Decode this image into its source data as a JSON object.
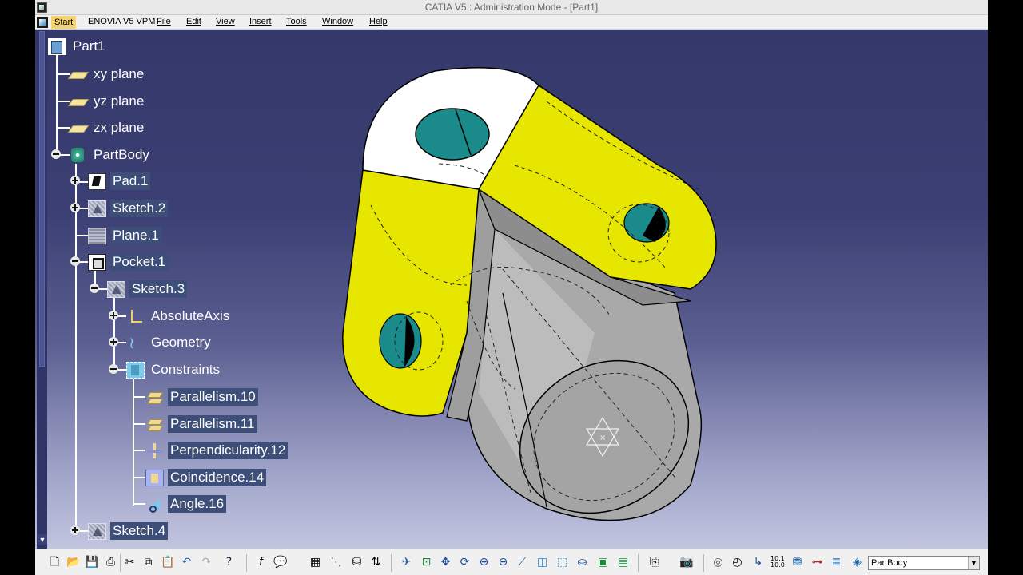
{
  "window": {
    "title": "CATIA V5 : Administration Mode - [Part1]"
  },
  "menu": {
    "start": "Start",
    "enovia": "ENOVIA V5 VPM",
    "file": "File",
    "edit": "Edit",
    "view": "View",
    "insert": "Insert",
    "tools": "Tools",
    "window": "Window",
    "help": "Help"
  },
  "tree": {
    "part": "Part1",
    "xy_plane": "xy plane",
    "yz_plane": "yz plane",
    "zx_plane": "zx plane",
    "partbody": "PartBody",
    "pad1": "Pad.1",
    "sketch2": "Sketch.2",
    "plane1": "Plane.1",
    "pocket1": "Pocket.1",
    "sketch3": "Sketch.3",
    "absolute_axis": "AbsoluteAxis",
    "geometry": "Geometry",
    "constraints": "Constraints",
    "parallelism10": "Parallelism.10",
    "parallelism11": "Parallelism.11",
    "perpendicularity12": "Perpendicularity.12",
    "coincidence14": "Coincidence.14",
    "angle16": "Angle.16",
    "sketch4": "Sketch.4"
  },
  "toolbar": {
    "current_body": "PartBody",
    "icons": [
      "new-icon",
      "open-icon",
      "save-icon",
      "print-icon",
      "cut-icon",
      "copy-icon",
      "paste-icon",
      "undo-icon",
      "redo-icon",
      "whats-this-icon",
      "formula-icon",
      "knowledge-icon",
      "table-icon",
      "catalog-icon",
      "design-table-icon",
      "hide-show-icon",
      "fly-mode-icon",
      "fit-all-icon",
      "pan-icon",
      "rotate-icon",
      "zoom-in-icon",
      "zoom-out-icon",
      "normal-view-icon",
      "iso-view-icon",
      "view-modes-icon",
      "render-style-icon",
      "hide-icon",
      "swap-space-icon",
      "capture-icon",
      "analysis-icon",
      "axis-system-icon",
      "measure-icon",
      "tolerance-icon",
      "scale-icon",
      "filter-icon",
      "body-icon"
    ],
    "small_label_top": "10.1",
    "small_label_bottom": "10.0"
  },
  "colors": {
    "face_yellow": "#e6e600",
    "face_white": "#ffffff",
    "face_gray": "#a9a9a9",
    "hole_teal": "#1a8a8a",
    "background_top": "#35386a",
    "background_bottom": "#c2c5df"
  }
}
